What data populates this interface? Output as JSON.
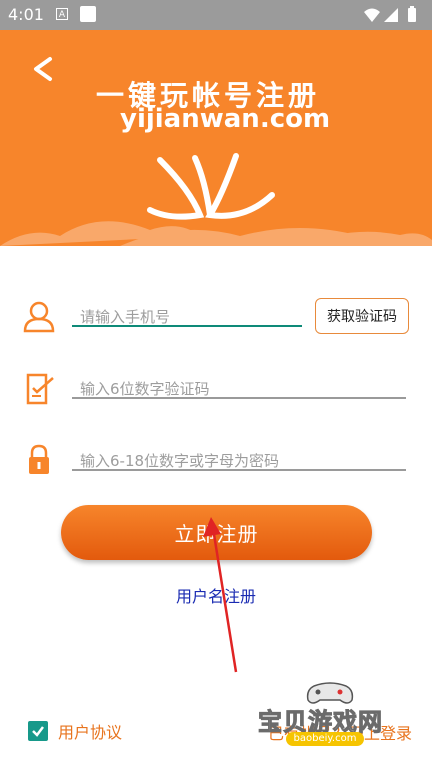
{
  "status_bar": {
    "time": "4:01",
    "notif_icon": "A"
  },
  "header": {
    "title_cn": "一键玩帐号注册",
    "title_en": "yijianwan.com"
  },
  "form": {
    "phone_placeholder": "请输入手机号",
    "code_button": "获取验证码",
    "code_placeholder": "输入6位数字验证码",
    "password_placeholder": "输入6-18位数字或字母为密码"
  },
  "actions": {
    "register_button": "立即注册",
    "username_register_link": "用户名注册"
  },
  "footer": {
    "agreement_label": "用户协议",
    "agreement_checked": true,
    "login_link": "已有帐号？马上登录"
  },
  "watermark": {
    "text": "宝贝游戏网",
    "url": "baobeiy.com"
  },
  "colors": {
    "accent": "#f7852b",
    "active_underline": "#0e8a78",
    "link": "#1a2bb2",
    "checkbox": "#17998a"
  }
}
